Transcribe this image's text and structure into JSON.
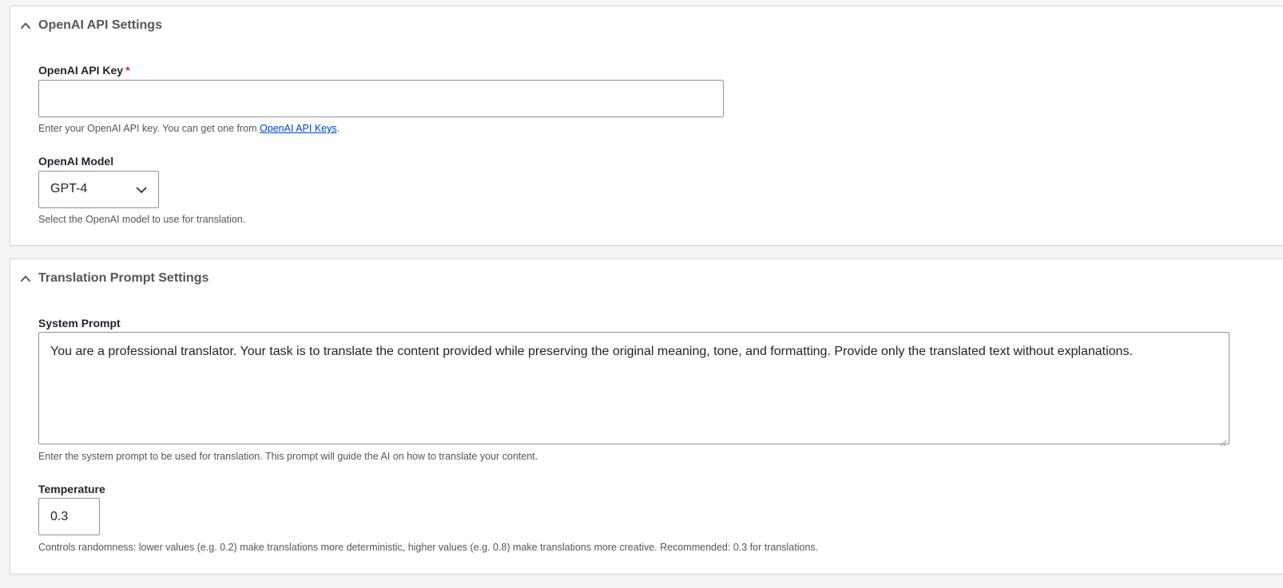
{
  "sections": {
    "openai": {
      "title": "OpenAI API Settings",
      "api_key": {
        "label": "OpenAI API Key",
        "required_marker": "*",
        "value": "",
        "description_prefix": "Enter your OpenAI API key. You can get one from ",
        "description_link": "OpenAI API Keys",
        "description_suffix": "."
      },
      "model": {
        "label": "OpenAI Model",
        "selected": "GPT-4",
        "description": "Select the OpenAI model to use for translation."
      }
    },
    "prompt": {
      "title": "Translation Prompt Settings",
      "system_prompt": {
        "label": "System Prompt",
        "value": "You are a professional translator. Your task is to translate the content provided while preserving the original meaning, tone, and formatting. Provide only the translated text without explanations.",
        "description": "Enter the system prompt to be used for translation. This prompt will guide the AI on how to translate your content."
      },
      "temperature": {
        "label": "Temperature",
        "value": "0.3",
        "description": "Controls randomness: lower values (e.g. 0.2) make translations more deterministic, higher values (e.g. 0.8) make translations more creative. Recommended: 0.3 for translations."
      }
    }
  },
  "icons": {
    "section_toggle": "chevron-up-icon",
    "select_arrow": "chevron-down-icon"
  },
  "colors": {
    "required": "#dc2323",
    "link": "#003ecc",
    "section_title": "#55565b"
  }
}
